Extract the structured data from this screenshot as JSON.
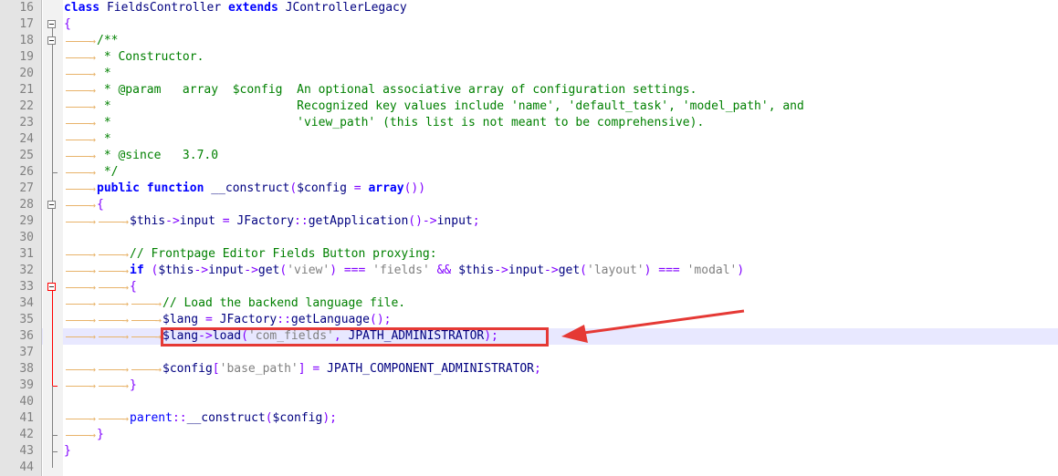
{
  "editor": {
    "lines": [
      {
        "n": "16",
        "t": "class FieldsController extends JControllerLegacy"
      },
      {
        "n": "17",
        "t": "{"
      },
      {
        "n": "18",
        "t": "/**"
      },
      {
        "n": "19",
        "t": " * Constructor."
      },
      {
        "n": "20",
        "t": " *"
      },
      {
        "n": "21",
        "t": " * @param   array  $config  An optional associative array of configuration settings."
      },
      {
        "n": "22",
        "t": " *                          Recognized key values include 'name', 'default_task', 'model_path', and"
      },
      {
        "n": "23",
        "t": " *                          'view_path' (this list is not meant to be comprehensive)."
      },
      {
        "n": "24",
        "t": " *"
      },
      {
        "n": "25",
        "t": " * @since   3.7.0"
      },
      {
        "n": "26",
        "t": " */"
      },
      {
        "n": "27",
        "t": "public function __construct($config = array())"
      },
      {
        "n": "28",
        "t": "{"
      },
      {
        "n": "29",
        "t": "$this->input = JFactory::getApplication()->input;"
      },
      {
        "n": "30",
        "t": ""
      },
      {
        "n": "31",
        "t": "// Frontpage Editor Fields Button proxying:"
      },
      {
        "n": "32",
        "t": "if ($this->input->get('view') === 'fields' && $this->input->get('layout') === 'modal')"
      },
      {
        "n": "33",
        "t": "{"
      },
      {
        "n": "34",
        "t": "// Load the backend language file."
      },
      {
        "n": "35",
        "t": "$lang = JFactory::getLanguage();"
      },
      {
        "n": "36",
        "t": "$lang->load('com_fields', JPATH_ADMINISTRATOR);"
      },
      {
        "n": "37",
        "t": ""
      },
      {
        "n": "38",
        "t": "$config['base_path'] = JPATH_COMPONENT_ADMINISTRATOR;"
      },
      {
        "n": "39",
        "t": "}"
      },
      {
        "n": "40",
        "t": ""
      },
      {
        "n": "41",
        "t": "parent::__construct($config);"
      },
      {
        "n": "42",
        "t": "}"
      },
      {
        "n": "43",
        "t": "}"
      },
      {
        "n": "44",
        "t": ""
      }
    ]
  },
  "colors": {
    "gutter_bg": "#e4e4e4",
    "keyword": "#0000ff",
    "comment": "#008000",
    "string": "#808080",
    "highlight_line": "#e8e8ff",
    "annotation_red": "#e53935"
  },
  "icons": [
    "fold-minus-icon",
    "tab-arrow-icon",
    "annotation-arrow-icon"
  ]
}
